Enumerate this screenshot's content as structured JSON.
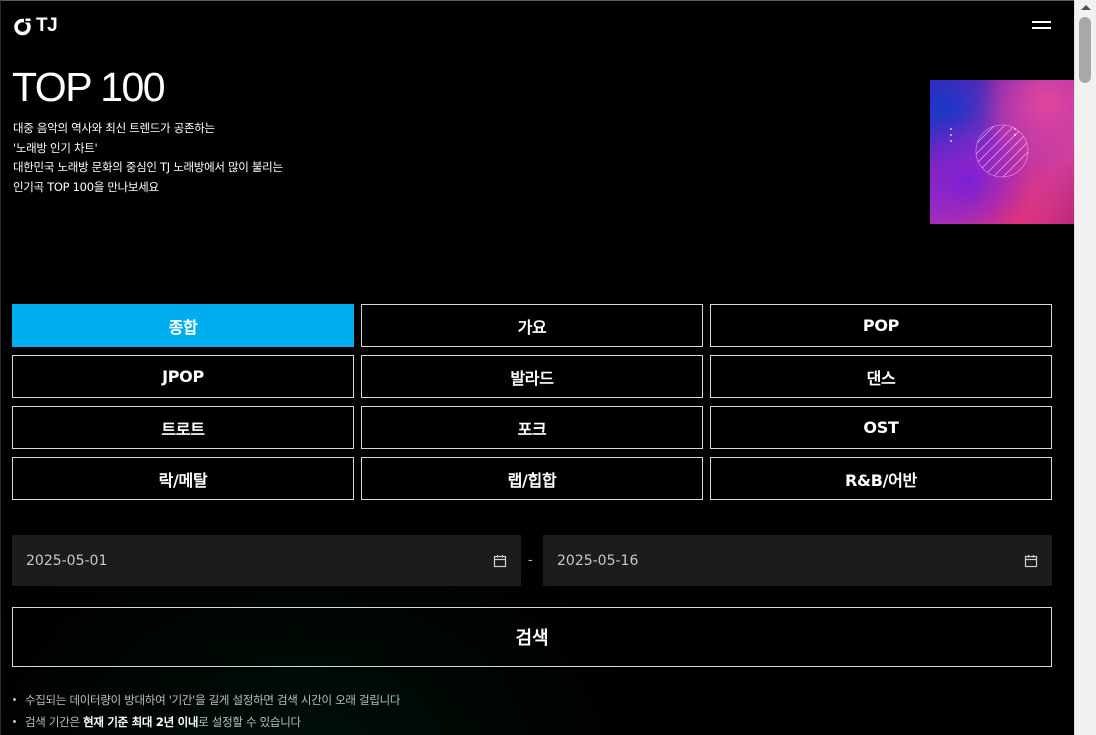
{
  "header": {
    "logo_text": "TJ",
    "logo_icon": "tj-logo-mark",
    "menu_icon": "hamburger-icon"
  },
  "hero": {
    "title": "TOP 100",
    "description": [
      "대중 음악의 역사와 최신 트렌드가 공존하는",
      "'노래방 인기 차트'",
      "대한민국 노래방 문화의 중심인 TJ 노래방에서 많이 불리는",
      "인기곡 TOP 100을 만나보세요"
    ]
  },
  "genres": [
    {
      "label": "종합",
      "active": true
    },
    {
      "label": "가요",
      "active": false
    },
    {
      "label": "POP",
      "active": false
    },
    {
      "label": "JPOP",
      "active": false
    },
    {
      "label": "발라드",
      "active": false
    },
    {
      "label": "댄스",
      "active": false
    },
    {
      "label": "트로트",
      "active": false
    },
    {
      "label": "포크",
      "active": false
    },
    {
      "label": "OST",
      "active": false
    },
    {
      "label": "락/메탈",
      "active": false
    },
    {
      "label": "랩/힙합",
      "active": false
    },
    {
      "label": "R&B/어반",
      "active": false
    }
  ],
  "date_range": {
    "start": "2025-05-01",
    "separator": "-",
    "end": "2025-05-16",
    "icon": "calendar-icon"
  },
  "search": {
    "label": "검색"
  },
  "notes": {
    "line1": "수집되는 데이터량이 방대하여 '기간'을 길게 설정하면 검색 시간이 오래 걸립니다",
    "line2_prefix": "검색 기간은 ",
    "line2_bold": "현재 기준 최대 2년 이내",
    "line2_suffix": "로 설정할 수 있습니다"
  },
  "colors": {
    "accent": "#00aeef",
    "background": "#000000",
    "field_bg": "#1c1c1c"
  }
}
